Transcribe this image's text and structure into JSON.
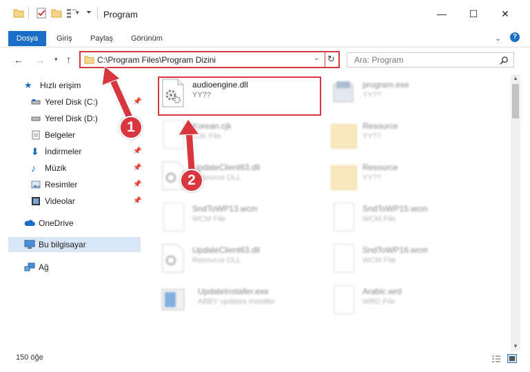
{
  "window": {
    "title": "Program",
    "minimize_glyph": "—",
    "maximize_glyph": "☐",
    "close_glyph": "✕"
  },
  "ribbon": {
    "tabs": [
      "Dosya",
      "Giriş",
      "Paylaş",
      "Görünüm"
    ]
  },
  "address": {
    "path": "C:\\Program Files\\Program Dizini"
  },
  "search": {
    "placeholder": "Ara: Program"
  },
  "nav": {
    "items": [
      {
        "label": "Hızlı erişim",
        "icon": "star-icon"
      },
      {
        "label": "Yerel Disk (C:)",
        "icon": "drive-icon"
      },
      {
        "label": "Yerel Disk (D:)",
        "icon": "drive-icon"
      },
      {
        "label": "Belgeler",
        "icon": "documents-icon"
      },
      {
        "label": "İndirmeler",
        "icon": "download-icon"
      },
      {
        "label": "Müzik",
        "icon": "music-icon"
      },
      {
        "label": "Resimler",
        "icon": "pictures-icon"
      },
      {
        "label": "Videolar",
        "icon": "video-icon"
      },
      {
        "label": "OneDrive",
        "icon": "cloud-icon"
      },
      {
        "label": "Bu bilgisayar",
        "icon": "computer-icon"
      },
      {
        "label": "Ağ",
        "icon": "network-icon"
      }
    ]
  },
  "files": [
    {
      "name": "audioengine.dll",
      "type": "YY??",
      "icon": "dll-gear-icon"
    },
    {
      "name": "program.exe",
      "type": "YY??",
      "icon": "exe-icon"
    },
    {
      "name": "Korean.cjk",
      "type": "CJK File",
      "icon": "document-icon"
    },
    {
      "name": "Resource",
      "type": "YY??",
      "icon": "folder-icon"
    },
    {
      "name": "UpdateClient63.dll",
      "type": "Resource DLL",
      "icon": "dll-gear-icon"
    },
    {
      "name": "Resource",
      "type": "YY??",
      "icon": "folder-icon"
    },
    {
      "name": "SndToWP13.wcm",
      "type": "WCM File",
      "icon": "document-icon"
    },
    {
      "name": "SndToWP15.wcm",
      "type": "WCM File",
      "icon": "document-icon"
    },
    {
      "name": "UpdateClient63.dll",
      "type": "Resource DLL",
      "icon": "dll-gear-icon"
    },
    {
      "name": "SndToWP16.wcm",
      "type": "WCM File",
      "icon": "document-icon"
    },
    {
      "name": "UpdateInstaller.exe",
      "type": "ABBY updates installer",
      "icon": "installer-icon"
    },
    {
      "name": "Arabic.wrd",
      "type": "WRD File",
      "icon": "document-icon"
    }
  ],
  "status": {
    "count": "150 öğe"
  },
  "annotations": {
    "badge1": "1",
    "badge2": "2"
  },
  "colors": {
    "accent": "#1a6ec8",
    "highlight": "#d9373f",
    "selection": "#d8e6f5"
  }
}
